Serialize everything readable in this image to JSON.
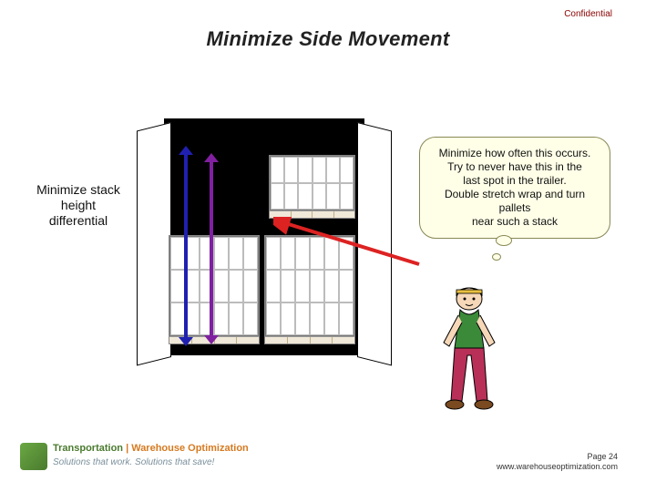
{
  "header": {
    "confidential": "Confidential",
    "title": "Minimize Side Movement"
  },
  "left_label": "Minimize stack height differential",
  "bubble": {
    "line1": "Minimize how often this occurs.",
    "line2": "Try to never have this in the",
    "line3": "last spot in the trailer.",
    "line4": "Double stretch wrap and turn",
    "line5": "pallets",
    "line6": "near such a stack"
  },
  "logo": {
    "brand_a": "Transportation",
    "sep": " | ",
    "brand_b": "Warehouse Optimization",
    "tagline": "Solutions that work. Solutions that save!"
  },
  "footer": {
    "page": "Page 24",
    "url": "www.warehouseoptimization.com"
  },
  "icons": {
    "arrow_blue": "vertical-double-arrow",
    "arrow_purple": "vertical-double-arrow",
    "arrow_red": "pointer-arrow",
    "worker": "cartoon-worker"
  }
}
